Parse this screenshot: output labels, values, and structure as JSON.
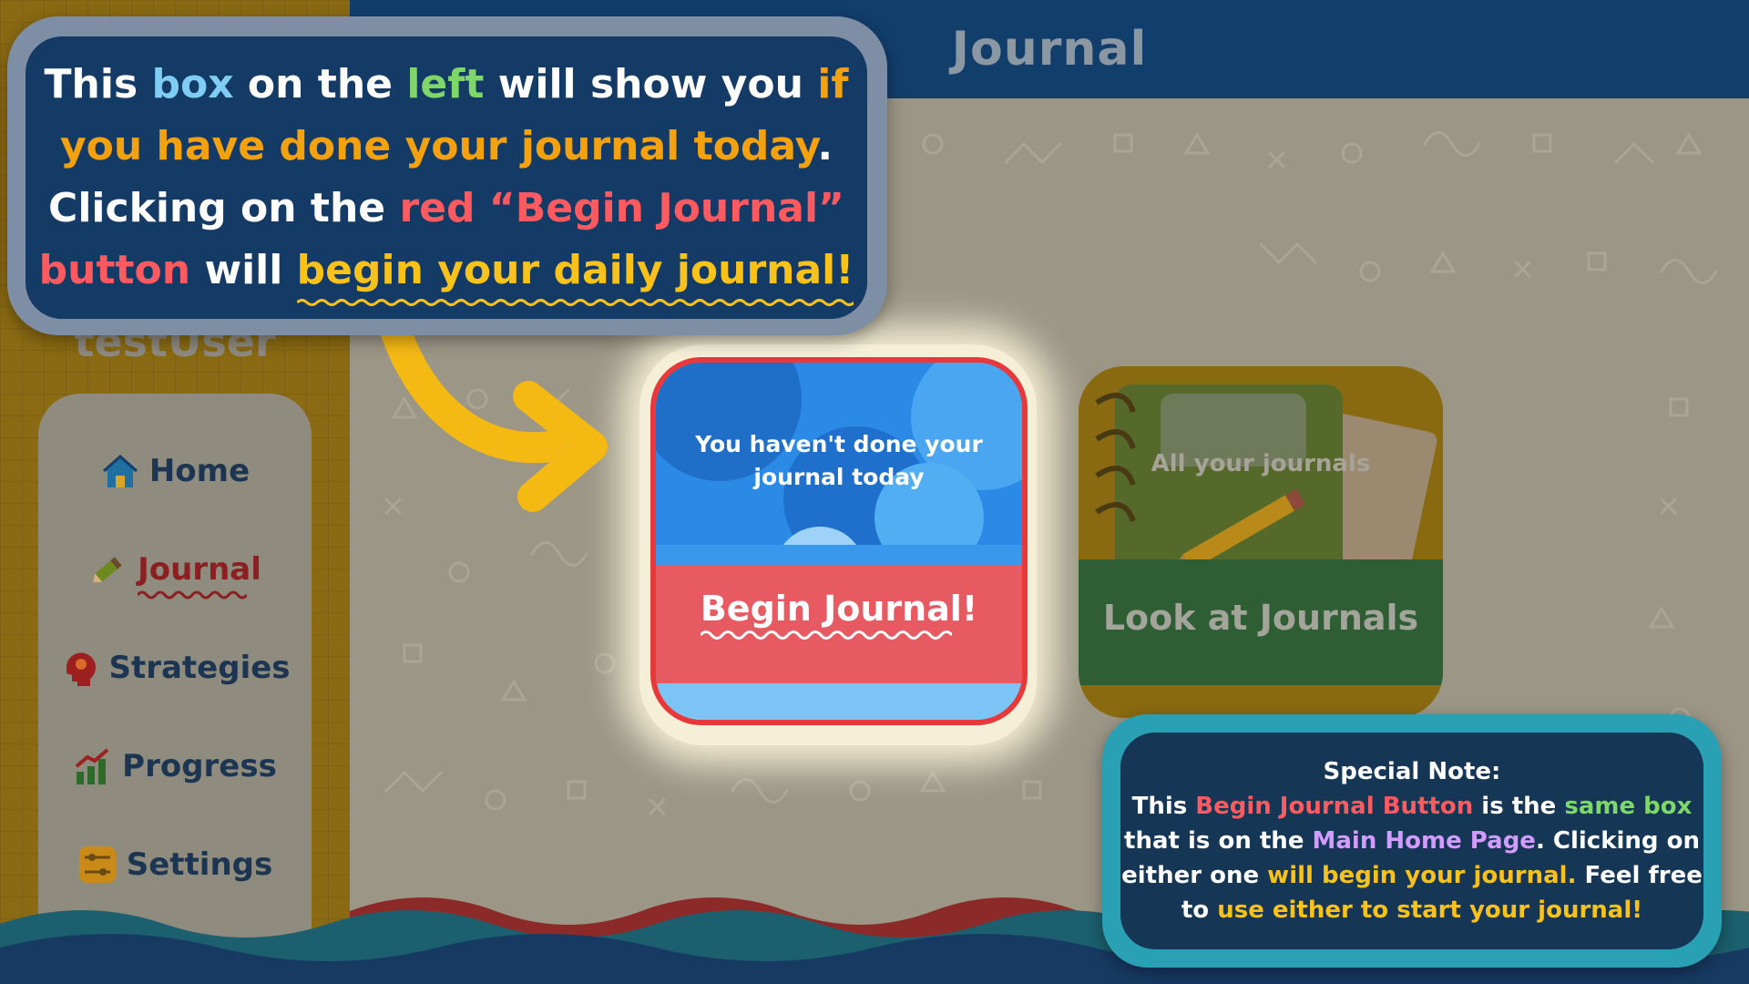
{
  "header": {
    "title": "Journal"
  },
  "sidebar": {
    "username": "testUser",
    "items": [
      {
        "label": "Home",
        "icon": "home-icon"
      },
      {
        "label": "Journal",
        "icon": "pencil-icon",
        "active": true
      },
      {
        "label": "Strategies",
        "icon": "head-icon"
      },
      {
        "label": "Progress",
        "icon": "chart-icon"
      },
      {
        "label": "Settings",
        "icon": "sliders-icon"
      }
    ]
  },
  "journal_card": {
    "status_line1": "You haven't done your",
    "status_line2": "journal today",
    "button_label": "Begin Journal!"
  },
  "look_card": {
    "caption": "All your journals",
    "button_label": "Look at Journals"
  },
  "callout": {
    "l1_a": "This ",
    "l1_b": "box",
    "l1_c": " on the ",
    "l1_d": "left",
    "l1_e": " will show you ",
    "l1_f": "if",
    "l2_a": "you have done your journal today",
    "l2_b": ".",
    "l3_a": "Clicking on the ",
    "l3_b": "red “Begin Journal”",
    "l4_a": "button",
    "l4_b": " will ",
    "l4_c": "begin your daily journal!"
  },
  "note": {
    "title": "Special Note:",
    "l1_a": "This ",
    "l1_b": "Begin Journal Button",
    "l1_c": " is the ",
    "l1_d": "same box",
    "l2_a": "that is on the ",
    "l2_b": "Main Home Page",
    "l2_c": ". Clicking on",
    "l3_a": "either one ",
    "l3_b": "will begin your journal.",
    "l3_c": " Feel free",
    "l4_a": "to ",
    "l4_b": "use either to start your journal!"
  },
  "colors": {
    "header": "#123e6c",
    "sidebar": "#8a6a12",
    "accent_red": "#e8383a",
    "callout_bg": "#143a66",
    "note_border": "#2aa0b4"
  }
}
